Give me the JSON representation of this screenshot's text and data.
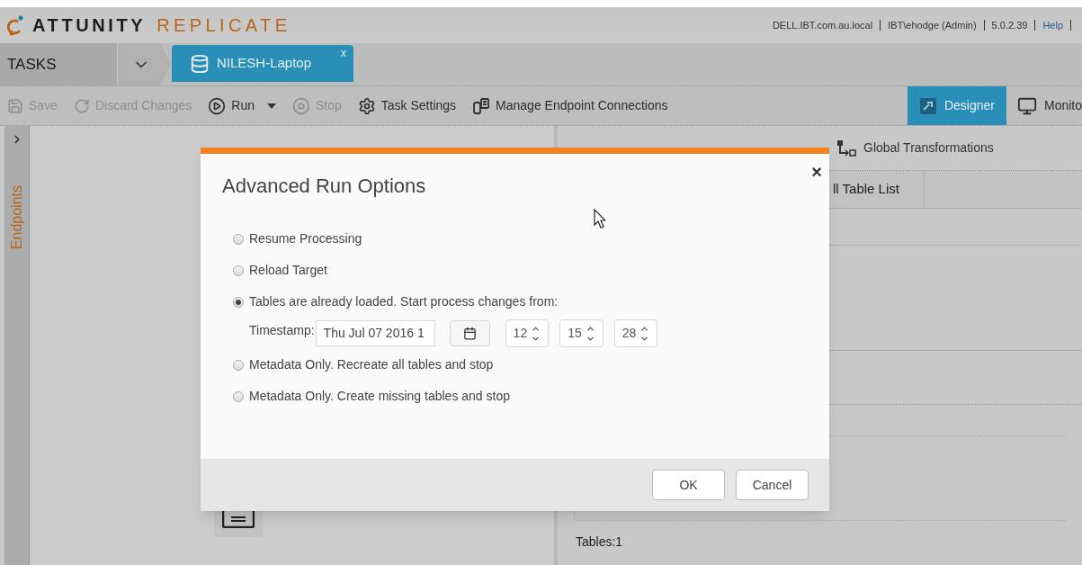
{
  "header": {
    "logo_primary": "ATTUNITY",
    "logo_secondary": "REPLICATE",
    "info": [
      "DELL.IBT.com.au.local",
      "IBT\\ehodge (Admin)",
      "5.0.2.39"
    ],
    "help_link": "Help"
  },
  "tabs_bar": {
    "section": "TASKS",
    "task_tab": {
      "label": "NILESH-Laptop",
      "close": "x",
      "selected": true
    }
  },
  "toolbar": {
    "items": [
      {
        "kind": "save",
        "label": "Save",
        "disabled": true
      },
      {
        "kind": "discard",
        "label": "Discard Changes",
        "disabled": true
      },
      {
        "kind": "run",
        "label": "Run",
        "disabled": false
      },
      {
        "kind": "stop",
        "label": "Stop",
        "disabled": true
      },
      {
        "kind": "settings",
        "label": "Task Settings",
        "disabled": false
      },
      {
        "kind": "endpoints",
        "label": "Manage Endpoint Connections",
        "disabled": false
      }
    ],
    "views": [
      {
        "kind": "designer",
        "label": "Designer",
        "selected": true
      },
      {
        "kind": "monitor",
        "label": "Monito",
        "selected": false
      }
    ]
  },
  "sidebar": {
    "label": "Endpoints"
  },
  "right_panel": {
    "action": "Global Transformations",
    "list_tab": "ll Table List",
    "footer": "Tables:1"
  },
  "dialog": {
    "title": "Advanced Run Options",
    "close": "×",
    "options": [
      {
        "label": "Resume Processing",
        "selected": false
      },
      {
        "label": "Reload Target",
        "selected": false
      },
      {
        "label": "Tables are already loaded. Start process changes from:",
        "selected": true
      },
      {
        "label": "Metadata Only. Recreate all tables and stop",
        "selected": false
      },
      {
        "label": "Metadata Only. Create missing tables and stop",
        "selected": false
      }
    ],
    "timestamp": {
      "label": "Timestamp:",
      "date": "Thu Jul 07 2016 1",
      "hour": "12",
      "minute": "15",
      "second": "28"
    },
    "buttons": [
      "OK",
      "Cancel"
    ]
  }
}
